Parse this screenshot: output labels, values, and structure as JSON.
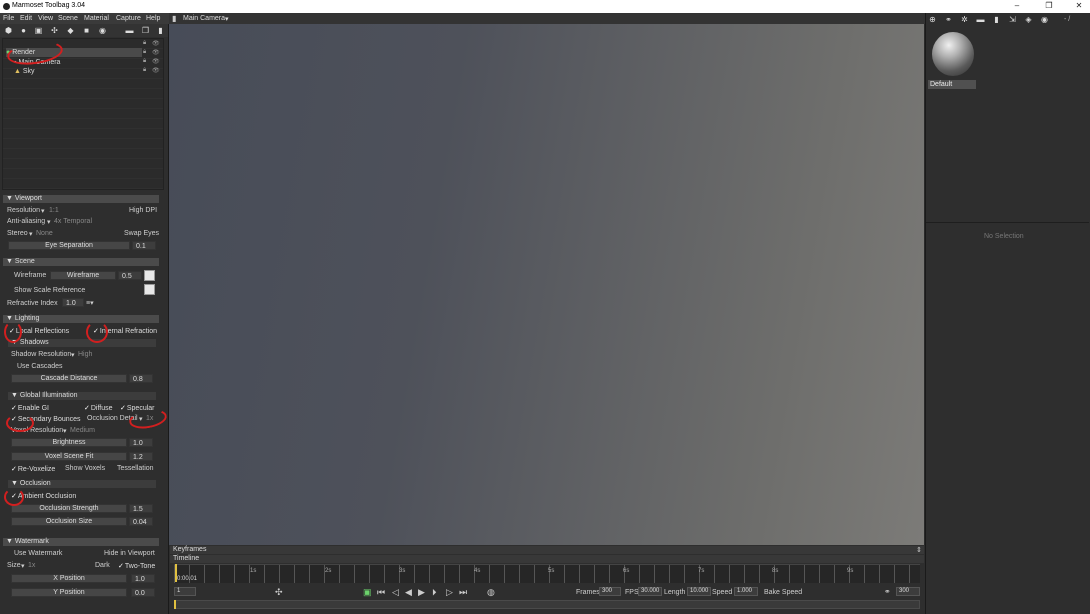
{
  "window": {
    "title": "Marmoset Toolbag 3.04",
    "minimize": "–",
    "maximize": "❐",
    "close": "✕"
  },
  "menu": [
    "File",
    "Edit",
    "View",
    "Scene",
    "Material",
    "Capture",
    "Help"
  ],
  "view_header": {
    "camera_label": "Main Camera"
  },
  "scene_tree": [
    {
      "label": "Render"
    },
    {
      "label": "Main Camera"
    },
    {
      "label": "Sky"
    }
  ],
  "viewport_section": {
    "title": "Viewport",
    "resolution_label": "Resolution",
    "resolution_value": "1:1",
    "high_dpi": "High DPI",
    "antialias_label": "Anti-aliasing",
    "antialias_value": "4x Temporal",
    "stereo_label": "Stereo",
    "stereo_value": "None",
    "swap_eyes": "Swap Eyes",
    "eye_sep_label": "Eye Separation",
    "eye_sep_value": "0.1"
  },
  "scene_section": {
    "title": "Scene",
    "wireframe_chk": "Wireframe",
    "wireframe_slider": "Wireframe",
    "wireframe_value": "0.5",
    "show_scale": "Show Scale Reference",
    "refractive_label": "Refractive Index",
    "refractive_value": "1.0"
  },
  "lighting_section": {
    "title": "Lighting",
    "local_reflections": "Local Reflections",
    "internal_refraction": "Internal Refraction",
    "shadows_title": "Shadows",
    "shadow_res_label": "Shadow Resolution",
    "shadow_res_value": "High",
    "use_cascades": "Use Cascades",
    "cascade_label": "Cascade Distance",
    "cascade_value": "0.8",
    "gi_title": "Global Illumination",
    "enable_gi": "Enable GI",
    "diffuse": "Diffuse",
    "specular": "Specular",
    "secondary_bounces": "Secondary Bounces",
    "occlusion_detail": "Occlusion Detail",
    "occlusion_detail_value": "1x",
    "voxel_res_label": "Voxel Resolution",
    "voxel_res_value": "Medium",
    "brightness_label": "Brightness",
    "brightness_value": "1.0",
    "voxel_fit_label": "Voxel Scene Fit",
    "voxel_fit_value": "1.2",
    "revoxelize": "Re-Voxelize",
    "show_voxels": "Show Voxels",
    "tessellation": "Tessellation",
    "occlusion_title": "Occlusion",
    "ambient_occlusion": "Ambient Occlusion",
    "occ_strength_label": "Occlusion Strength",
    "occ_strength_value": "1.5",
    "occ_size_label": "Occlusion Size",
    "occ_size_value": "0.04"
  },
  "watermark_section": {
    "title": "Watermark",
    "use_watermark": "Use Watermark",
    "hide_in_viewport": "Hide in Viewport",
    "size_label": "Size",
    "size_value": "1x",
    "dark": "Dark",
    "two_tone": "Two-Tone",
    "xpos_label": "X Position",
    "xpos_value": "1.0",
    "ypos_label": "Y Position",
    "ypos_value": "0.0"
  },
  "material": {
    "name": "Default",
    "no_selection": "No Selection",
    "counter": "- /"
  },
  "timeline": {
    "keyframes_label": "Keyframes",
    "timeline_label": "Timeline",
    "current_time": "0:00.01",
    "ticks": [
      "1s",
      "2s",
      "3s",
      "4s",
      "5s",
      "6s",
      "7s",
      "8s",
      "9s"
    ],
    "frame_field": "1",
    "frames_label": "Frames",
    "frames_value": "300",
    "fps_label": "FPS",
    "fps_value": "30.000",
    "length_label": "Length",
    "length_value": "10.000",
    "speed_label": "Speed",
    "speed_value": "1.000",
    "bake_speed": "Bake Speed",
    "end_frame": "300"
  }
}
